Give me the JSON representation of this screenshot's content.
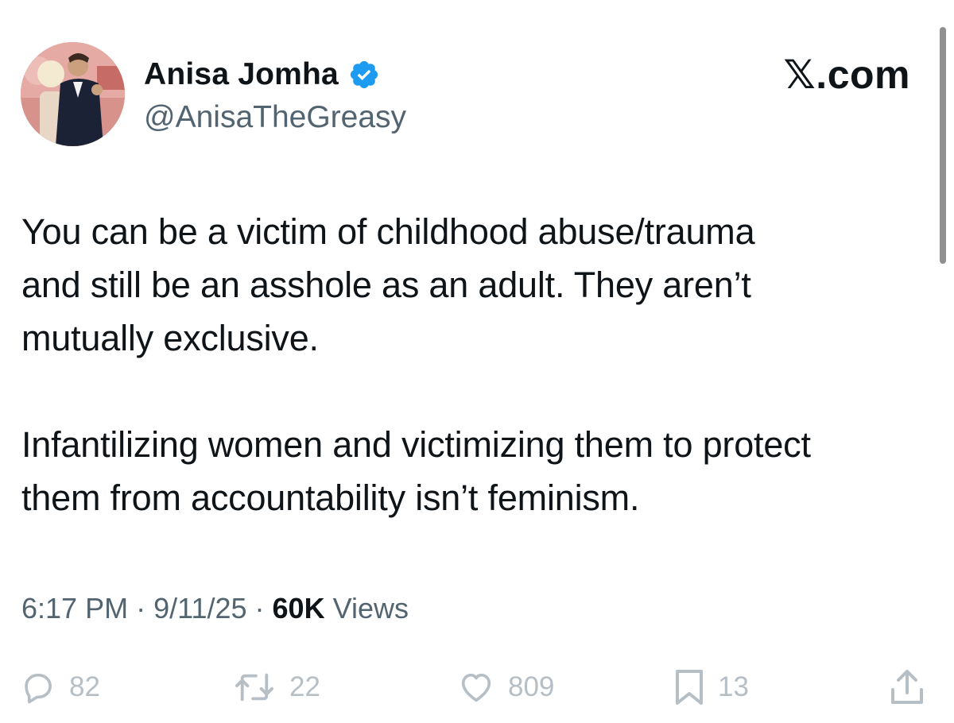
{
  "author": {
    "display_name": "Anisa Jomha",
    "handle": "@AnisaTheGreasy",
    "verified_icon": "verified-badge-icon",
    "badge_color": "#1d9bf0"
  },
  "site_label": "𝕏.com",
  "tweet": {
    "paragraph_1": [
      "You can be a victim of childhood abuse/trauma",
      "and still be an asshole as an adult. They aren’t",
      "mutually exclusive."
    ],
    "paragraph_2": [
      "Infantilizing women and victimizing them to protect",
      "them from accountability isn’t feminism."
    ]
  },
  "meta": {
    "time": "6:17 PM",
    "separator": " · ",
    "date": "9/11/25",
    "views_count": "60K",
    "views_label": " Views"
  },
  "actions": {
    "replies": {
      "icon": "reply-icon",
      "count": "82"
    },
    "reposts": {
      "icon": "repost-icon",
      "count": "22"
    },
    "likes": {
      "icon": "like-icon",
      "count": "809"
    },
    "bookmarks": {
      "icon": "bookmark-icon",
      "count": "13"
    },
    "share": {
      "icon": "share-icon"
    }
  },
  "colors": {
    "text_primary": "#0f1419",
    "text_secondary": "#536471",
    "action_icons": "#b6bec6"
  }
}
